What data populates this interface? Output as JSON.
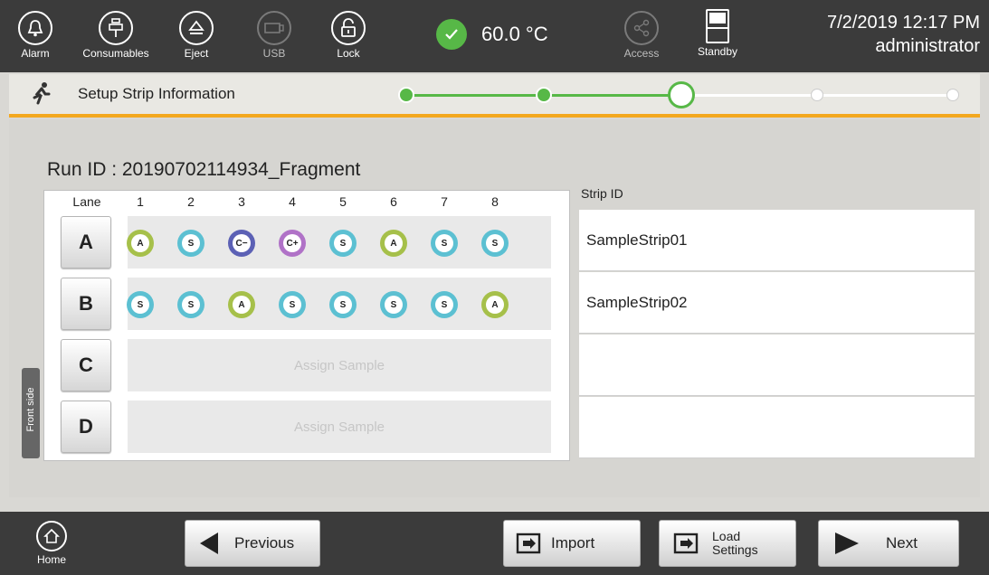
{
  "topbar": {
    "alarm": "Alarm",
    "consumables": "Consumables",
    "eject": "Eject",
    "usb": "USB",
    "lock": "Lock",
    "temperature": "60.0 °C",
    "access": "Access",
    "standby": "Standby",
    "datetime": "7/2/2019 12:17 PM",
    "user": "administrator"
  },
  "stepbar": {
    "title": "Setup Strip Information",
    "steps_completed": 2,
    "current_step": 3,
    "total_steps": 5,
    "accent_color": "#f3a81f",
    "progress_color": "#57b847"
  },
  "main": {
    "run_id": "Run ID :  20190702114934_Fragment",
    "lane_header": "Lane",
    "columns": [
      "1",
      "2",
      "3",
      "4",
      "5",
      "6",
      "7",
      "8"
    ],
    "lanes": [
      {
        "label": "A",
        "wells": [
          "A",
          "S",
          "C−",
          "C+",
          "S",
          "A",
          "S",
          "S"
        ]
      },
      {
        "label": "B",
        "wells": [
          "S",
          "S",
          "A",
          "S",
          "S",
          "S",
          "S",
          "A"
        ]
      },
      {
        "label": "C",
        "assign": "Assign Sample"
      },
      {
        "label": "D",
        "assign": "Assign Sample"
      }
    ],
    "strip_id_header": "Strip ID",
    "strip_ids": [
      "SampleStrip01",
      "SampleStrip02",
      "",
      ""
    ],
    "front_side": "Front side",
    "well_colors": {
      "A": "#a6c04a",
      "S": "#5cc0d2",
      "C−": "#5c61b5",
      "C+": "#b072c7"
    }
  },
  "bottombar": {
    "home": "Home",
    "previous": "Previous",
    "import": "Import",
    "load_settings_line1": "Load",
    "load_settings_line2": "Settings",
    "next": "Next"
  }
}
